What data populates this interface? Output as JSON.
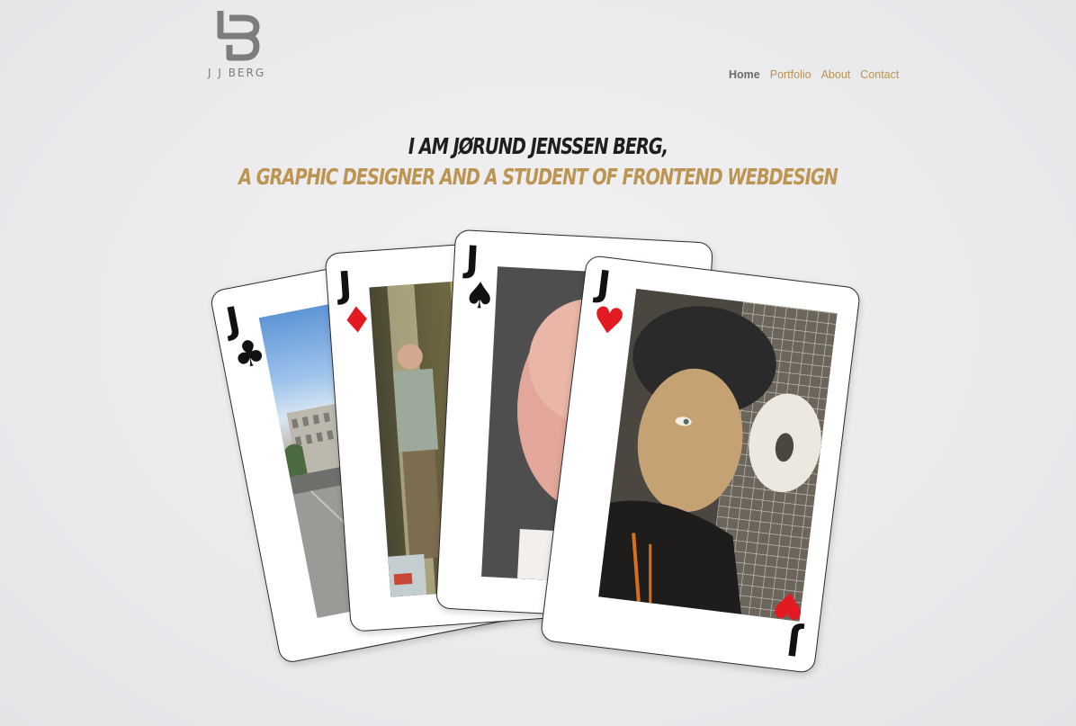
{
  "brand": {
    "name": "J J BERG"
  },
  "nav": {
    "items": [
      {
        "label": "Home",
        "active": true
      },
      {
        "label": "Portfolio",
        "active": false
      },
      {
        "label": "About",
        "active": false
      },
      {
        "label": "Contact",
        "active": false
      }
    ]
  },
  "hero": {
    "line1": "I am Jørund Jenssen Berg,",
    "line2": "a graphic designer and a student of frontend webdesign"
  },
  "colors": {
    "accent": "#bc9552",
    "heading": "#1e1e1e",
    "nav_active": "#6c6c6c",
    "suit_red": "#e21b23",
    "suit_black": "#111111"
  },
  "cards": [
    {
      "rank": "J",
      "suit": "clubs",
      "suit_glyph": "♣",
      "color": "black",
      "photo": "street-with-palm-trees-photo"
    },
    {
      "rank": "J",
      "suit": "diamonds",
      "suit_glyph": "♦",
      "color": "red",
      "photo": "man-in-doorway-photo"
    },
    {
      "rank": "J",
      "suit": "spades",
      "suit_glyph": "♠",
      "color": "black",
      "photo": "bald-man-portrait-photo"
    },
    {
      "rank": "J",
      "suit": "hearts",
      "suit_glyph": "♥",
      "color": "red",
      "photo": "man-in-beanie-photo"
    }
  ]
}
